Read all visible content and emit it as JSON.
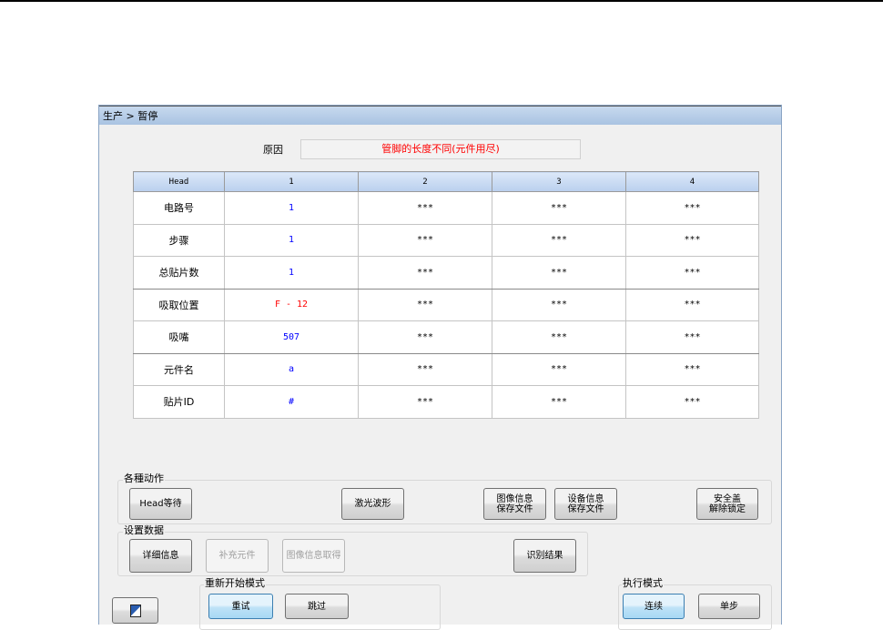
{
  "title": "生产 > 暂停",
  "reason": {
    "label": "原因",
    "value": "管脚的长度不同(元件用尽)"
  },
  "table": {
    "headers": [
      "Head",
      "1",
      "2",
      "3",
      "4"
    ],
    "rows": [
      {
        "label": "电路号",
        "values": [
          "1",
          "***",
          "***",
          "***"
        ]
      },
      {
        "label": "步骤",
        "values": [
          "1",
          "***",
          "***",
          "***"
        ]
      },
      {
        "label": "总贴片数",
        "values": [
          "1",
          "***",
          "***",
          "***"
        ]
      },
      {
        "label": "吸取位置",
        "values": [
          "F - 12",
          "***",
          "***",
          "***"
        ]
      },
      {
        "label": "吸嘴",
        "values": [
          "507",
          "***",
          "***",
          "***"
        ]
      },
      {
        "label": "元件名",
        "values": [
          "a",
          "***",
          "***",
          "***"
        ]
      },
      {
        "label": "贴片ID",
        "values": [
          "#",
          "***",
          "***",
          "***"
        ]
      }
    ]
  },
  "actions": {
    "label": "各種动作",
    "head_wait": "Head等待",
    "laser": "激光波形",
    "img_save_1": "图像信息",
    "img_save_2": "保存文件",
    "dev_save_1": "设备信息",
    "dev_save_2": "保存文件",
    "cover_1": "安全盖",
    "cover_2": "解除锁定"
  },
  "settings": {
    "label": "设置数据",
    "detail": "详细信息",
    "supplement": "补充元件",
    "img_get": "图像信息取得",
    "result": "识别结果"
  },
  "restart": {
    "label": "重新开始模式",
    "retry": "重试",
    "skip": "跳过"
  },
  "exec": {
    "label": "执行模式",
    "continuous": "连续",
    "step": "单步"
  }
}
